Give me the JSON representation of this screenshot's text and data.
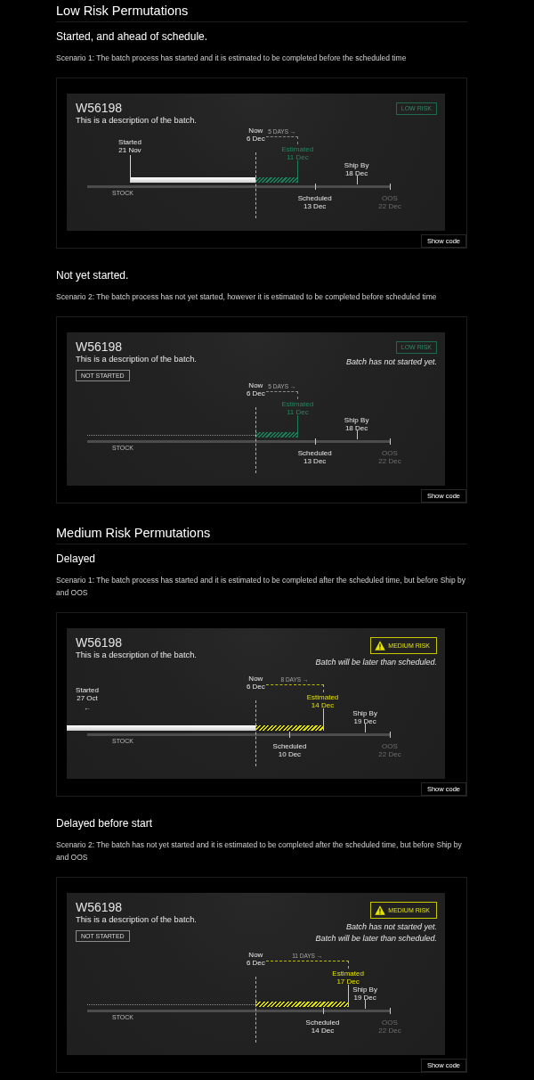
{
  "sections": [
    {
      "heading": "Low Risk Permutations",
      "scenarios": [
        {
          "title": "Started, and ahead of schedule.",
          "description": "Scenario 1: The batch process has started and it is estimated to be completed before the scheduled time",
          "card": {
            "batch_id": "W56198",
            "batch_description": "This is a description of the batch.",
            "risk": {
              "kind": "low",
              "label": "LOW RISK"
            },
            "timeline": {
              "axis_label": "STOCK",
              "started": {
                "label": "Started",
                "date": "21 Nov",
                "level": 0.141
              },
              "now": {
                "label": "Now",
                "date": "6 Dec",
                "level": 0.557
              },
              "estimate": {
                "label": "Estimated",
                "date": "11 Dec",
                "duration": "5 DAYS →",
                "level": 0.695
              },
              "markers": [
                {
                  "kind": "scheduled",
                  "label": "Scheduled",
                  "date": "13 Dec",
                  "level": 0.752
                },
                {
                  "kind": "ship_by",
                  "label": "Ship By",
                  "date": "18 Dec",
                  "level": 0.89
                },
                {
                  "kind": "oos",
                  "label": "OOS",
                  "date": "22 Dec",
                  "level": 1
                }
              ]
            }
          },
          "show_code": "Show code"
        },
        {
          "title": "Not yet started.",
          "description": "Scenario 2: The batch process has not yet started, however it is estimated to be completed before scheduled time",
          "card": {
            "batch_id": "W56198",
            "batch_description": "This is a description of the batch.",
            "status": "NOT STARTED",
            "risk": {
              "kind": "low",
              "label": "LOW RISK"
            },
            "messages": [
              "Batch has not started yet."
            ],
            "timeline": {
              "axis_label": "STOCK",
              "now": {
                "label": "Now",
                "date": "6 Dec",
                "level": 0.557
              },
              "estimate": {
                "label": "Estimated",
                "date": "11 Dec",
                "duration": "5 DAYS →",
                "level": 0.695
              },
              "markers": [
                {
                  "kind": "scheduled",
                  "label": "Scheduled",
                  "date": "13 Dec",
                  "level": 0.752
                },
                {
                  "kind": "ship_by",
                  "label": "Ship By",
                  "date": "18 Dec",
                  "level": 0.89
                },
                {
                  "kind": "oos",
                  "label": "OOS",
                  "date": "22 Dec",
                  "level": 1
                }
              ]
            }
          },
          "show_code": "Show code"
        }
      ]
    },
    {
      "heading": "Medium Risk Permutations",
      "scenarios": [
        {
          "title": "Delayed",
          "description": "Scenario 1: The batch process has started and it is estimated to be completed after the scheduled time, but before Ship by and OOS",
          "card": {
            "batch_id": "W56198",
            "batch_description": "This is a description of the batch.",
            "risk": {
              "kind": "medium",
              "label": "MEDIUM RISK"
            },
            "messages": [
              "Batch will be later than scheduled."
            ],
            "timeline": {
              "axis_label": "STOCK",
              "started": {
                "label": "Started",
                "date": "27 Oct",
                "arrow": "←",
                "level": 0
              },
              "now": {
                "label": "Now",
                "date": "6 Dec",
                "level": 0.557
              },
              "estimate": {
                "label": "Estimated",
                "date": "14 Dec",
                "duration": "8 DAYS →",
                "level": 0.778
              },
              "markers": [
                {
                  "kind": "scheduled",
                  "label": "Scheduled",
                  "date": "10 Dec",
                  "level": 0.669
                },
                {
                  "kind": "ship_by",
                  "label": "Ship By",
                  "date": "19 Dec",
                  "level": 0.918
                },
                {
                  "kind": "oos",
                  "label": "OOS",
                  "date": "22 Dec",
                  "level": 1
                }
              ]
            }
          },
          "show_code": "Show code"
        },
        {
          "title": "Delayed before start",
          "description": "Scenario 2: The batch has not yet started and it is estimated to be completed after the scheduled time, but before Ship by and OOS",
          "card": {
            "batch_id": "W56198",
            "batch_description": "This is a description of the batch.",
            "status": "NOT STARTED",
            "risk": {
              "kind": "medium",
              "label": "MEDIUM RISK"
            },
            "messages": [
              "Batch has not started yet.",
              "Batch will be later than scheduled."
            ],
            "timeline": {
              "axis_label": "STOCK",
              "now": {
                "label": "Now",
                "date": "6 Dec",
                "level": 0.557
              },
              "estimate": {
                "label": "Estimated",
                "date": "17 Dec",
                "duration": "11 DAYS →",
                "level": 0.862
              },
              "markers": [
                {
                  "kind": "scheduled",
                  "label": "Scheduled",
                  "date": "14 Dec",
                  "level": 0.778
                },
                {
                  "kind": "ship_by",
                  "label": "Ship By",
                  "date": "19 Dec",
                  "level": 0.918
                },
                {
                  "kind": "oos",
                  "label": "OOS",
                  "date": "22 Dec",
                  "level": 1
                }
              ]
            }
          },
          "show_code": "Show code"
        }
      ]
    }
  ]
}
